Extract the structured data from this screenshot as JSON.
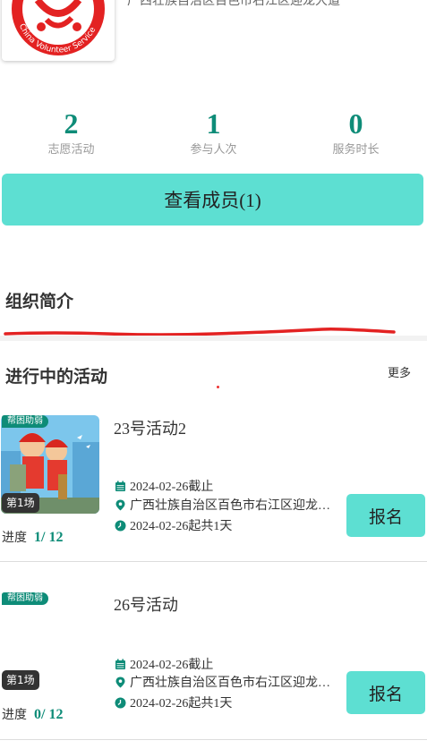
{
  "header": {
    "address": "广西壮族自治区百色市右江区迎龙大道",
    "logo_text": "China Volunteer Service"
  },
  "stats": [
    {
      "value": "2",
      "label": "志愿活动"
    },
    {
      "value": "1",
      "label": "参与人次"
    },
    {
      "value": "0",
      "label": "服务时长"
    }
  ],
  "members_button": "查看成员(1)",
  "intro": {
    "title": "组织简介"
  },
  "ongoing": {
    "title": "进行中的活动",
    "more": "更多"
  },
  "activities": [
    {
      "tag": "帮困助弱",
      "round": "第1场",
      "progress_label": "进度",
      "progress_current": "1/",
      "progress_total": " 12",
      "title": "23号活动2",
      "deadline": "2024-02-26截止",
      "location": "广西壮族自治区百色市右江区迎龙大道",
      "duration": "2024-02-26起共1天",
      "signup": "报名"
    },
    {
      "tag": "帮困助弱",
      "round": "第1场",
      "progress_label": "进度",
      "progress_current": "0/",
      "progress_total": " 12",
      "title": "26号活动",
      "deadline": "2024-02-26截止",
      "location": "广西壮族自治区百色市右江区迎龙大道",
      "duration": "2024-02-26起共1天",
      "signup": "报名"
    }
  ],
  "colors": {
    "accent": "#0e8c78",
    "button": "#5ddfd2",
    "red": "#e32222"
  },
  "icons": [
    "calendar-icon",
    "location-pin-icon",
    "clock-icon"
  ]
}
